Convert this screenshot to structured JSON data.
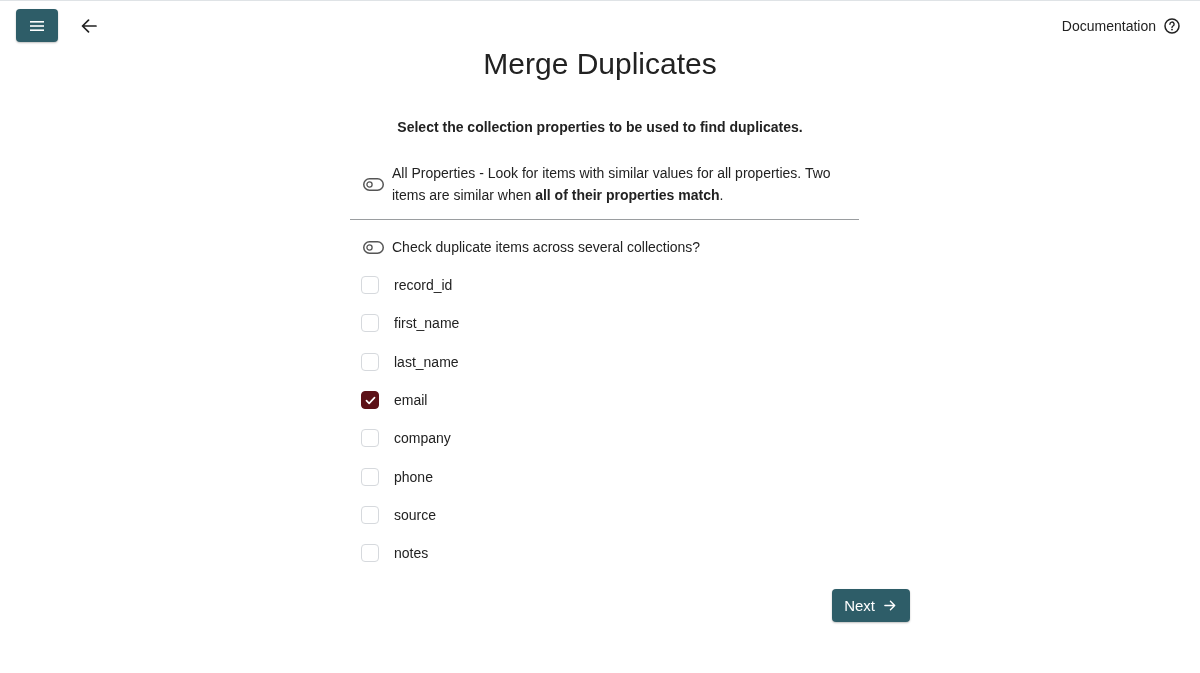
{
  "header": {
    "documentation_link": "Documentation"
  },
  "title": "Merge Duplicates",
  "instruction": "Select the collection properties to be used to find duplicates.",
  "toggles": [
    {
      "label": "All Properties - Look for items with similar values for all properties. Two items are similar when **all of their properties match**.",
      "on": false
    },
    {
      "label": "Check duplicate items across several collections?",
      "on": false
    }
  ],
  "properties": [
    {
      "label": "record_id",
      "checked": false
    },
    {
      "label": "first_name",
      "checked": false
    },
    {
      "label": "last_name",
      "checked": false
    },
    {
      "label": "email",
      "checked": true
    },
    {
      "label": "company",
      "checked": false
    },
    {
      "label": "phone",
      "checked": false
    },
    {
      "label": "source",
      "checked": false
    },
    {
      "label": "notes",
      "checked": false
    }
  ],
  "next_button": "Next"
}
